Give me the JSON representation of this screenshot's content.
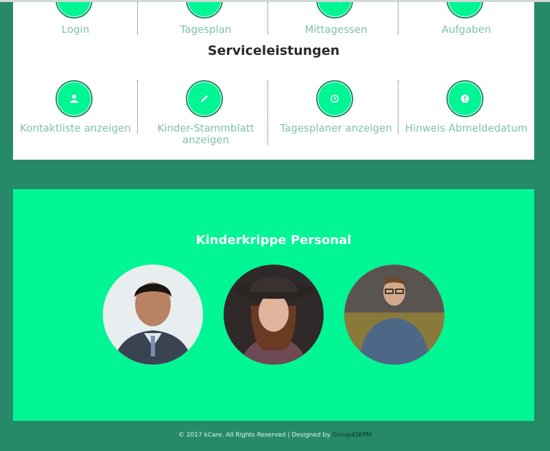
{
  "top_menu": {
    "items": [
      {
        "label": "Login",
        "icon": "login-icon"
      },
      {
        "label": "Tagesplan",
        "icon": "calendar-icon"
      },
      {
        "label": "Mittagessen",
        "icon": "food-icon"
      },
      {
        "label": "Aufgaben",
        "icon": "tasks-icon"
      }
    ]
  },
  "services": {
    "title": "Serviceleistungen",
    "items": [
      {
        "label": "Kontaktliste anzeigen",
        "icon": "user-icon"
      },
      {
        "label": "Kinder-Stammblatt anzeigen",
        "icon": "pencil-icon"
      },
      {
        "label": "Tagesplaner anzeigen",
        "icon": "clock-icon"
      },
      {
        "label": "Hinweis Abmeldedatum",
        "icon": "alert-icon"
      }
    ]
  },
  "staff": {
    "title": "Kinderkrippe Personal"
  },
  "footer": {
    "text": "© 2017 kCare. All Rights Reserved | Designed by ",
    "brand": "Group4SEPM"
  },
  "colors": {
    "page_bg": "#268a68",
    "accent": "#00f595",
    "label": "#7fc4a4"
  }
}
